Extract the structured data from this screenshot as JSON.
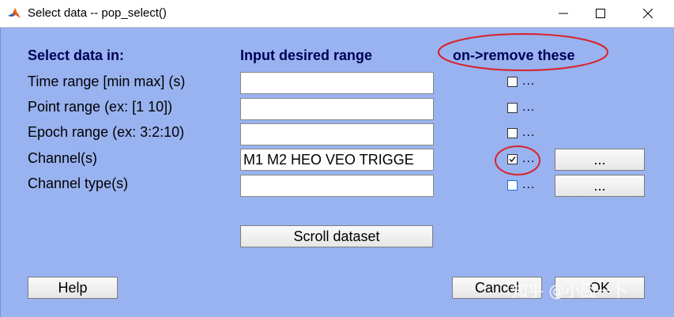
{
  "window": {
    "title": "Select data -- pop_select()"
  },
  "headers": {
    "select_in": "Select data in:",
    "input_range": "Input desired range",
    "remove": "on->remove these"
  },
  "rows": [
    {
      "label": "Time range [min max] (s)",
      "value": "",
      "checked": false,
      "dots": "...",
      "has_button": false
    },
    {
      "label": "Point range (ex: [1 10])",
      "value": "",
      "checked": false,
      "dots": "...",
      "has_button": false
    },
    {
      "label": "Epoch range (ex: 3:2:10)",
      "value": "",
      "checked": false,
      "dots": "...",
      "has_button": false
    },
    {
      "label": "Channel(s)",
      "value": "M1 M2 HEO VEO TRIGGE",
      "checked": true,
      "dots": "...",
      "has_button": true,
      "button_label": "..."
    },
    {
      "label": "Channel type(s)",
      "value": "",
      "checked": false,
      "dots": "...",
      "has_button": true,
      "button_label": "..."
    }
  ],
  "buttons": {
    "scroll": "Scroll dataset",
    "help": "Help",
    "cancel": "Cancel",
    "ok": "OK"
  },
  "watermark": "知乎 @小囧一卜",
  "colors": {
    "background": "#99b2f0",
    "annotation": "#d8232a",
    "header_text": "#000055"
  }
}
